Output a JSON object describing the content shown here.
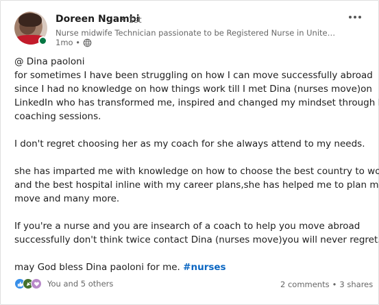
{
  "author": {
    "name": "Doreen Ngambi",
    "degree": "• 1st",
    "headline": "Nurse midwife Technician passionate to be Registered Nurse in United Kingdom...",
    "time": "1mo •"
  },
  "post": {
    "lines": [
      "@ Dina paoloni",
      "for sometimes I have been struggling on how I can move successfully abroad",
      "since I had no knowledge on how things work till I met Dina (nurses move)on",
      "LinkedIn who has transformed me, inspired and changed my mindset through her",
      "coaching sessions.",
      "",
      "I don't regret choosing her as my coach for she always attend to my needs.",
      "",
      "she has imparted me with knowledge on how to choose the best country to work",
      "and the best hospital inline with my career plans,she has helped me to plan my",
      "move and many more.",
      "",
      "If you're a nurse and you are insearch of a coach to help you move abroad",
      "successfully don't think twice contact Dina (nurses move)you will never regret.",
      ""
    ],
    "last_line": "may God bless Dina paoloni for me.",
    "hashtag": "#nurses"
  },
  "social": {
    "reactions_text": "You and 5 others",
    "comments": "2 comments",
    "separator": "•",
    "shares": "3 shares"
  },
  "colors": {
    "link": "#0a66c2",
    "online": "#057642"
  }
}
